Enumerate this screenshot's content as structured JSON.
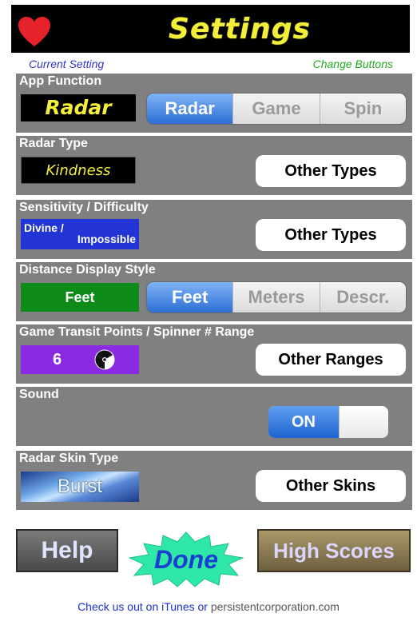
{
  "header": {
    "title": "Settings",
    "icon": "heart-icon",
    "accent": "#f3ee3a"
  },
  "columns": {
    "current": "Current Setting",
    "change": "Change Buttons"
  },
  "sections": {
    "app_function": {
      "title": "App Function",
      "current": "Radar",
      "options": [
        "Radar",
        "Game",
        "Spin"
      ],
      "selected": "Radar"
    },
    "radar_type": {
      "title": "Radar Type",
      "current": "Kindness",
      "button": "Other Types"
    },
    "sensitivity": {
      "title": "Sensitivity / Difficulty",
      "current_line1": "Divine /",
      "current_line2": "Impossible",
      "button": "Other Types"
    },
    "distance": {
      "title": "Distance Display Style",
      "current": "Feet",
      "options": [
        "Feet",
        "Meters",
        "Descr."
      ],
      "selected": "Feet"
    },
    "range": {
      "title": "Game Transit Points / Spinner # Range",
      "current": "6",
      "icon": "radiation-icon",
      "button": "Other Ranges"
    },
    "sound": {
      "title": "Sound",
      "toggle": "ON"
    },
    "skin": {
      "title": "Radar Skin Type",
      "current": "Burst",
      "button": "Other Skins"
    }
  },
  "bottom": {
    "help": "Help",
    "done": "Done",
    "high_scores": "High Scores"
  },
  "footer": {
    "text": "Check us out on iTunes or",
    "site": "persistentcorporation.com"
  }
}
